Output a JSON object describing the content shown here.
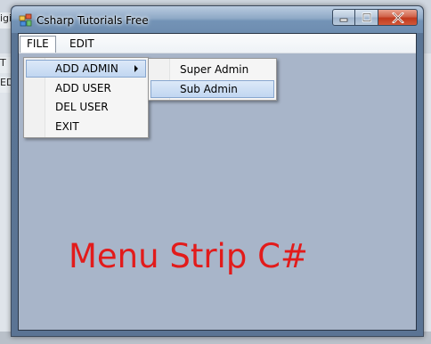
{
  "window": {
    "title": "Csharp Tutorials Free"
  },
  "background": {
    "fragments": [
      "igi",
      "T",
      "EDI"
    ]
  },
  "menubar": {
    "items": [
      {
        "label": "FILE"
      },
      {
        "label": "EDIT"
      }
    ]
  },
  "file_menu": {
    "items": [
      {
        "label": "ADD ADMIN",
        "has_submenu": true
      },
      {
        "label": "ADD USER"
      },
      {
        "label": "DEL USER"
      },
      {
        "label": "EXIT"
      }
    ]
  },
  "admin_submenu": {
    "items": [
      {
        "label": "Super Admin"
      },
      {
        "label": "Sub Admin"
      }
    ]
  },
  "canvas": {
    "label": "Menu Strip C#",
    "label_color": "#e21b1b"
  },
  "colors": {
    "client_bg": "#a8b5c9",
    "highlight": "#c1d6f1",
    "close_button": "#c0391d"
  },
  "icons": [
    "app-window-icon",
    "minimize-icon",
    "maximize-icon",
    "close-icon",
    "submenu-arrow-icon"
  ]
}
